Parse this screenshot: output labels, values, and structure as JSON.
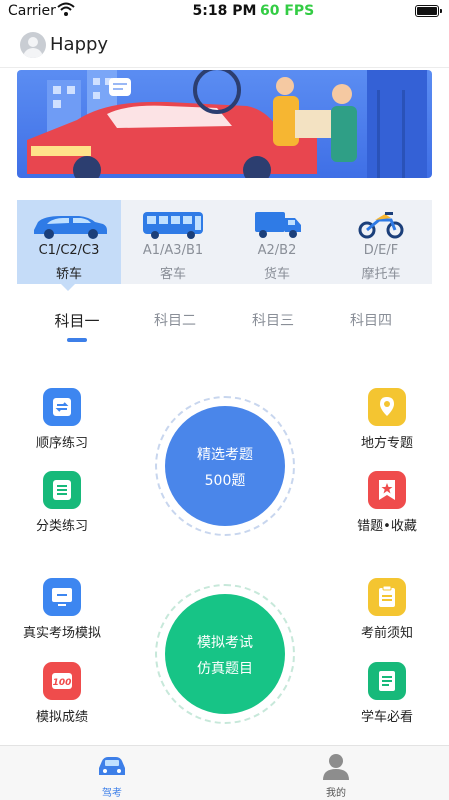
{
  "status_bar": {
    "carrier": "Carrier",
    "time": "5:18 PM",
    "fps": "60 FPS"
  },
  "header": {
    "user_name": "Happy"
  },
  "vehicle_tabs": [
    {
      "code": "C1/C2/C3",
      "name": "轿车",
      "icon": "car-icon",
      "active": true
    },
    {
      "code": "A1/A3/B1",
      "name": "客车",
      "icon": "bus-icon",
      "active": false
    },
    {
      "code": "A2/B2",
      "name": "货车",
      "icon": "truck-icon",
      "active": false
    },
    {
      "code": "D/E/F",
      "name": "摩托车",
      "icon": "motorcycle-icon",
      "active": false
    }
  ],
  "subject_tabs": [
    {
      "label": "科目一",
      "active": true
    },
    {
      "label": "科目二",
      "active": false
    },
    {
      "label": "科目三",
      "active": false
    },
    {
      "label": "科目四",
      "active": false
    }
  ],
  "practice": {
    "left": [
      {
        "label": "顺序练习",
        "icon": "sequential-icon",
        "color": "#3d86f0"
      },
      {
        "label": "分类练习",
        "icon": "category-list-icon",
        "color": "#17b97a"
      }
    ],
    "right": [
      {
        "label": "地方专题",
        "icon": "location-pin-icon",
        "color": "#f4c531"
      },
      {
        "label": "错题•收藏",
        "icon": "bookmark-star-icon",
        "color": "#ef4c4c"
      }
    ],
    "center": {
      "line1": "精选考题",
      "line2": "500题",
      "color": "#4a86ea"
    }
  },
  "exam": {
    "left": [
      {
        "label": "真实考场模拟",
        "icon": "monitor-icon",
        "color": "#3d86f0"
      },
      {
        "label": "模拟成绩",
        "icon": "score-100-icon",
        "color": "#ef4c4c"
      }
    ],
    "right": [
      {
        "label": "考前须知",
        "icon": "clipboard-icon",
        "color": "#f4c531"
      },
      {
        "label": "学车必看",
        "icon": "document-icon",
        "color": "#17b97a"
      }
    ],
    "center": {
      "line1": "模拟考试",
      "line2": "仿真题目",
      "color": "#17c486"
    }
  },
  "bottom_nav": [
    {
      "label": "驾考",
      "icon": "car-nav-icon",
      "active": true
    },
    {
      "label": "我的",
      "icon": "person-icon",
      "active": false
    }
  ]
}
